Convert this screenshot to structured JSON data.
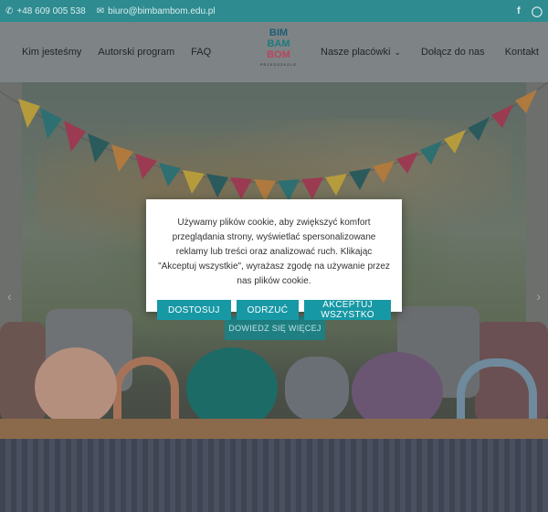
{
  "topbar": {
    "phone": "+48 609 005 538",
    "email": "biuro@bimbambom.edu.pl",
    "social": [
      "f",
      "◯"
    ]
  },
  "header": {
    "nav_left": [
      "Kim jesteśmy",
      "Autorski program",
      "FAQ"
    ],
    "nav_right": [
      "Nasze placówki",
      "Dołącz do nas",
      "Kontakt"
    ],
    "logo": {
      "line1": "BIM",
      "line2": "BAM",
      "line3": "BOM",
      "tagline": "PRZEDSZKOLE"
    }
  },
  "hero": {
    "cta_label": "DOWIEDZ SIĘ WIĘCEJ"
  },
  "cookie": {
    "text": "Używamy plików cookie, aby zwiększyć komfort przeglądania strony, wyświetlać spersonalizowane reklamy lub treści oraz analizować ruch. Klikając \"Akceptuj wszystkie\", wyrażasz zgodę na używanie przez nas plików cookie.",
    "btn_customize": "DOSTOSUJ",
    "btn_reject": "ODRZUĆ",
    "btn_accept": "AKCEPTUJ WSZYSTKO",
    "button_color": "#1798a5"
  },
  "colors": {
    "topbar": "#2e8b8f",
    "accent": "#1798a5"
  }
}
